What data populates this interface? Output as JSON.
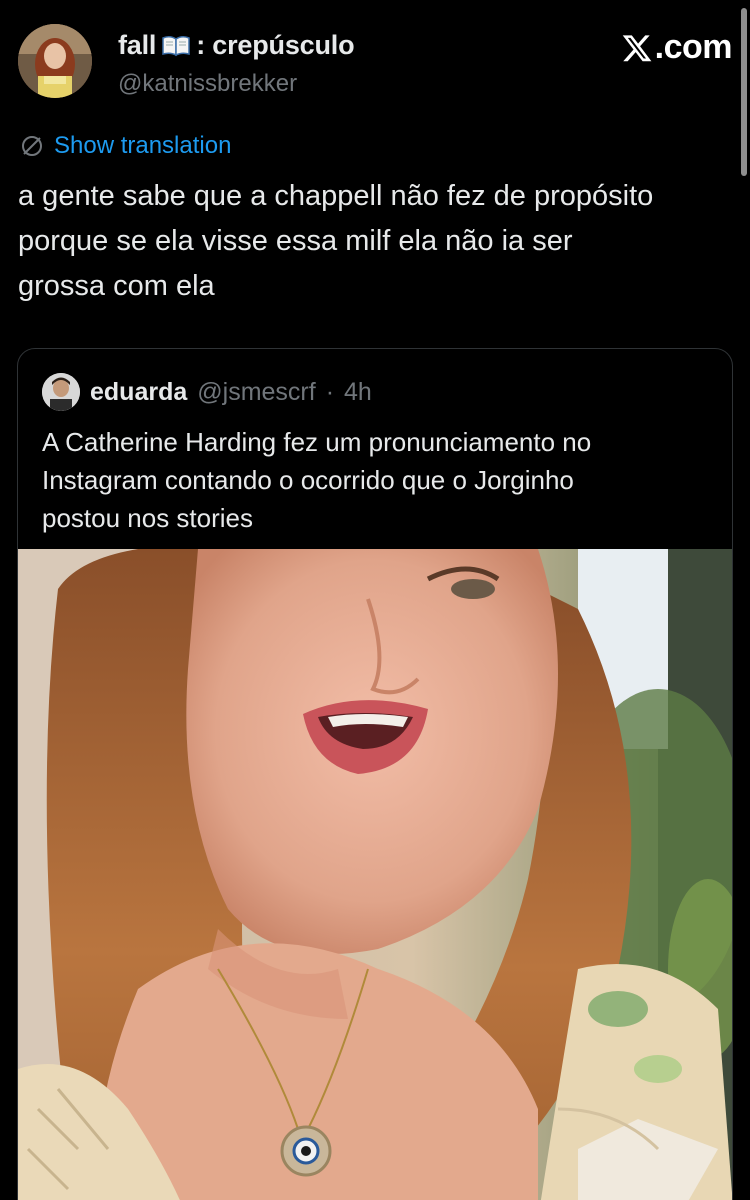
{
  "header": {
    "display_name_prefix": "fall",
    "display_name_suffix": ": crepúsculo",
    "handle": "@katnissbrekker",
    "site_label": ".com"
  },
  "translation": {
    "label": "Show translation"
  },
  "tweet": {
    "lines": [
      "a gente sabe que a chappell não fez de propósito",
      "porque se ela visse essa milf ela não ia ser",
      "grossa com ela"
    ]
  },
  "quote": {
    "name": "eduarda",
    "handle": "@jsmescrf",
    "separator": "·",
    "time": "4h",
    "lines": [
      "A Catherine Harding fez um pronunciamento no",
      "Instagram contando o ocorrido que o Jorginho",
      "postou nos stories"
    ]
  },
  "colors": {
    "background": "#000000",
    "text": "#e7e9ea",
    "muted": "#71767b",
    "link": "#1d9bf0",
    "border": "#2f3336"
  },
  "icons": [
    "book-emoji-icon",
    "x-logo-icon",
    "translate-globe-icon"
  ]
}
